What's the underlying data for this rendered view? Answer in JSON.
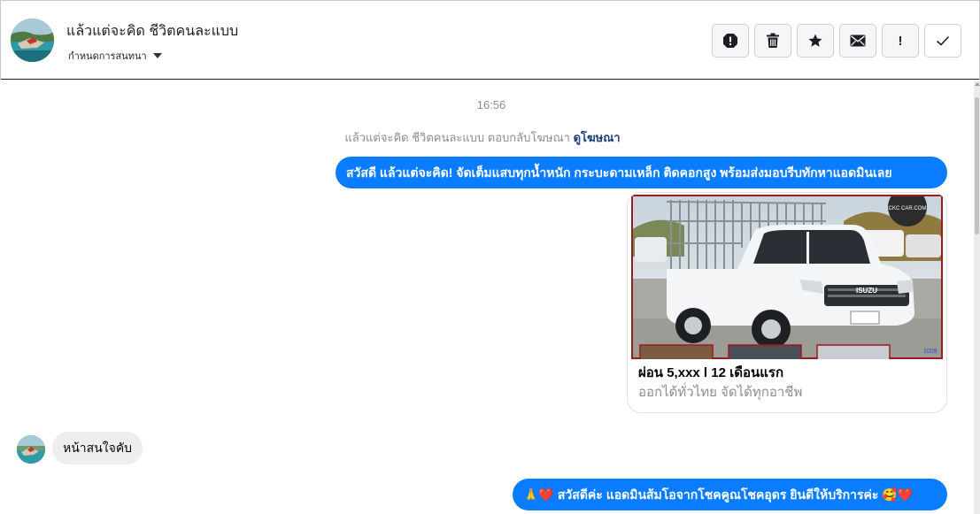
{
  "header": {
    "contact_name": "แล้วแต่จะคิด ชีวิตคนละแบบ",
    "subtitle": "กำหนดการสนทนา",
    "actions": [
      {
        "name": "report-icon"
      },
      {
        "name": "trash-icon"
      },
      {
        "name": "star-icon"
      },
      {
        "name": "envelope-icon"
      },
      {
        "name": "priority-icon",
        "glyph": "!"
      },
      {
        "name": "check-icon"
      }
    ]
  },
  "conversation": {
    "timestamp": "16:56",
    "ad_notice": {
      "text": "แล้วแต่จะคิด ชีวิตคนละแบบ ตอบกลับโฆษณา",
      "link": "ดูโฆษณา"
    },
    "messages": [
      {
        "direction": "outgoing",
        "text": "สวัสดี แล้วแต่จะคิด! จัดเต็มแสบทุกน้ำหนัก กระบะดามเหล็ก ติดคอกสูง พร้อมส่งมอบรีบทักหาแอดมินเลย"
      },
      {
        "direction": "outgoing",
        "type": "ad_card",
        "title": "ผ่อน 5,xxx l 12 เดือนแรก",
        "subtitle": "ออกได้ทั่วไทย จัดได้ทุกอาชีพ",
        "image_text": {
          "badge": "CKC CAR.COM",
          "brand": "ISUZU",
          "corner": "1009"
        }
      },
      {
        "direction": "incoming",
        "text": "หน้าสนใจคับ"
      },
      {
        "direction": "outgoing",
        "text": "สวัสดีค่ะ แอดมินส้มโอจากโชคคูณโชคอุดร ยินดีให้บริการค่ะ",
        "emoji_before": "🙏❤️",
        "emoji_after": "🥰❤️"
      }
    ]
  },
  "colors": {
    "outgoing_bubble": "#0a7cff",
    "incoming_bubble": "#eeeeee",
    "muted_text": "#8a8d91",
    "link_text": "#1c3f7a"
  }
}
